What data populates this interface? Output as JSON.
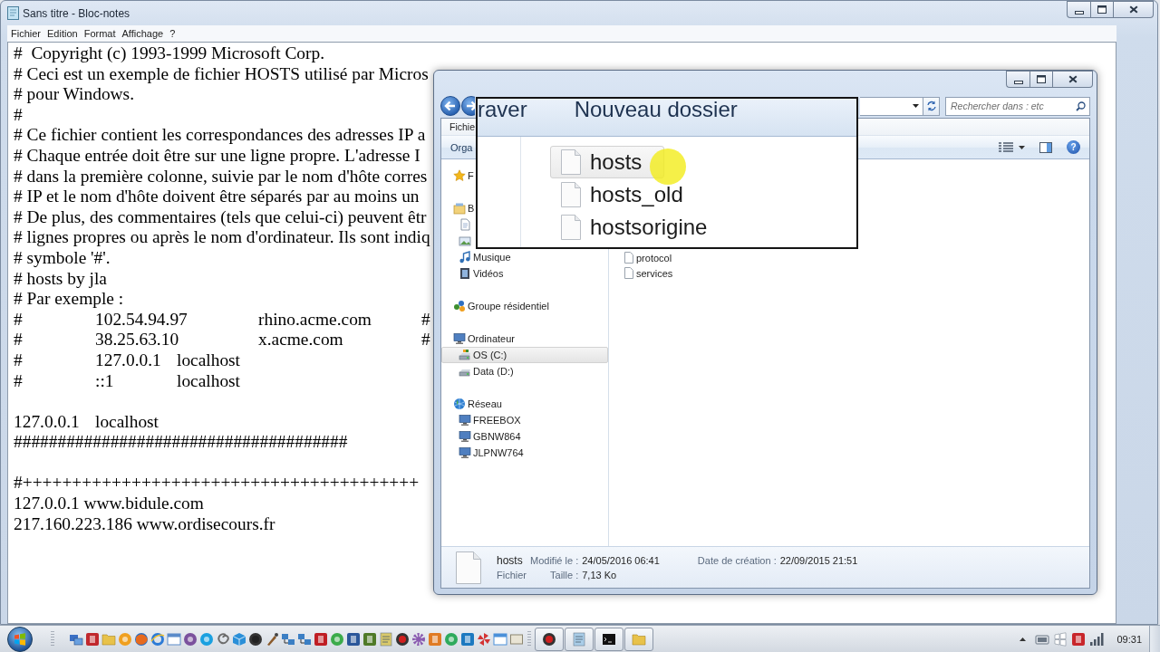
{
  "notepad": {
    "title": "Sans titre - Bloc-notes",
    "menu": [
      "Fichier",
      "Edition",
      "Format",
      "Affichage",
      "?"
    ],
    "paragraphs": [
      [
        "#  Copyright (c) 1993-1999 Microsoft Corp.",
        "# Ceci est un exemple de fichier HOSTS utilisé par Micros",
        "# pour Windows.",
        "#",
        "# Ce fichier contient les correspondances des adresses IP a",
        "# Chaque entrée doit être sur une ligne propre. L'adresse I",
        "# dans la première colonne, suivie par le nom d'hôte corres",
        "# IP et le nom d'hôte doivent être séparés par au moins un",
        "# De plus, des commentaires (tels que celui-ci) peuvent êtr",
        "# lignes propres ou après le nom d'ordinateur. Ils sont indiq",
        "# symbole '#'.",
        "# hosts by jla",
        "# Par exemple :",
        "#\t102.54.94.97\trhino.acme.com\t#",
        "#\t38.25.63.10\tx.acme.com\t#",
        "#\t127.0.0.1\tlocalhost",
        "#\t::1\tlocalhost"
      ],
      [
        "127.0.0.1\tlocalhost",
        "######################################"
      ],
      [
        "#++++++++++++++++++++++++++++++++++++++++",
        "127.0.0.1 www.bidule.com",
        "217.160.223.186 www.ordisecours.fr"
      ]
    ]
  },
  "explorer": {
    "search": {
      "placeholder": "Rechercher dans : etc"
    },
    "menu": [
      "Fichie"
    ],
    "toolbar": [
      "Orga"
    ],
    "help": "?",
    "nav": [
      {
        "kind": "favorites",
        "label": "F",
        "selected": false
      },
      {
        "kind": "libraries",
        "label": "B",
        "selected": false,
        "children": [
          {
            "kind": "documents",
            "selected": false
          },
          {
            "kind": "pictures",
            "selected": false
          },
          {
            "kind": "music",
            "label": "Musique",
            "selected": false
          },
          {
            "kind": "videos",
            "label": "Vidéos",
            "selected": false
          }
        ]
      },
      {
        "kind": "homegroup",
        "label": "Groupe résidentiel",
        "selected": false
      },
      {
        "kind": "computer",
        "label": "Ordinateur",
        "selected": false,
        "children": [
          {
            "kind": "system_drive",
            "label": "OS (C:)",
            "selected": true
          },
          {
            "kind": "drive",
            "label": "Data (D:)",
            "selected": false
          }
        ]
      },
      {
        "kind": "network",
        "label": "Réseau",
        "selected": false,
        "children": [
          {
            "kind": "pc",
            "label": "FREEBOX",
            "selected": false
          },
          {
            "kind": "pc",
            "label": "GBNW864",
            "selected": false
          },
          {
            "kind": "pc",
            "label": "JLPNW764",
            "selected": false
          }
        ]
      }
    ],
    "files": [
      {
        "name": "protocol",
        "selected": false
      },
      {
        "name": "services",
        "selected": false
      }
    ],
    "details": {
      "name": "hosts",
      "type": "Fichier",
      "fields": [
        {
          "label": "Modifié le :",
          "value": "24/05/2016 06:41"
        },
        {
          "label": "Taille :",
          "value": "7,13 Ko"
        },
        {
          "label": "Date de création :",
          "value": "22/09/2015 21:51"
        }
      ]
    }
  },
  "magnifier": {
    "toolbar": [
      "raver",
      "Nouveau dossier"
    ],
    "files": [
      {
        "name": "hosts",
        "selected": true
      },
      {
        "name": "hosts_old",
        "selected": false
      },
      {
        "name": "hostsorigine",
        "selected": false
      }
    ]
  },
  "taskbar": {
    "clock": "09:31"
  }
}
